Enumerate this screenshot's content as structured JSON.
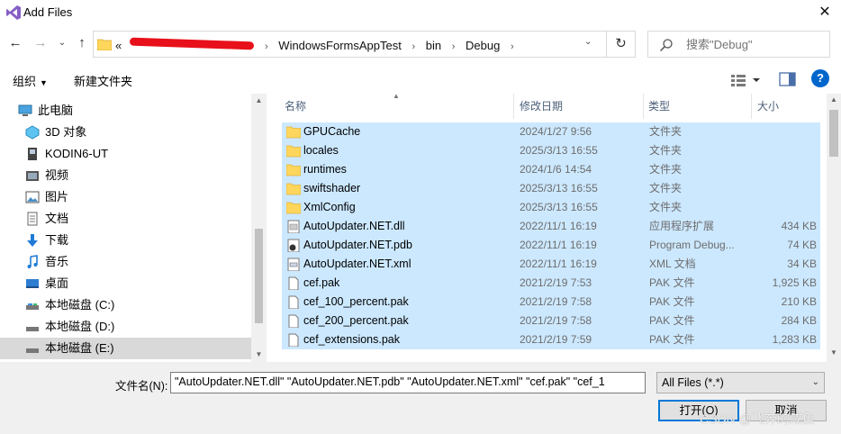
{
  "window": {
    "title": "Add Files",
    "close_glyph": "✕"
  },
  "nav": {
    "back_glyph": "←",
    "forward_glyph": "→",
    "recent_glyph": "⌄",
    "up_glyph": "↑",
    "address_prefix": "«",
    "crumbs": [
      "WindowsFormsAppTest",
      "bin",
      "Debug"
    ],
    "refresh_glyph": "↻",
    "search_placeholder": "搜索\"Debug\""
  },
  "toolbar": {
    "organize": "组织",
    "organize_arrow": "▼",
    "new_folder": "新建文件夹",
    "help": "?"
  },
  "sidebar": {
    "items": [
      {
        "label": "此电脑",
        "icon": "pc-icon"
      },
      {
        "label": "3D 对象",
        "icon": "3d-objects-icon"
      },
      {
        "label": "KODIN6-UT",
        "icon": "drive-icon"
      },
      {
        "label": "视频",
        "icon": "video-icon"
      },
      {
        "label": "图片",
        "icon": "pictures-icon"
      },
      {
        "label": "文档",
        "icon": "documents-icon"
      },
      {
        "label": "下载",
        "icon": "download-icon"
      },
      {
        "label": "音乐",
        "icon": "music-icon"
      },
      {
        "label": "桌面",
        "icon": "desktop-icon"
      },
      {
        "label": "本地磁盘 (C:)",
        "icon": "disk-icon"
      },
      {
        "label": "本地磁盘 (D:)",
        "icon": "disk-icon"
      },
      {
        "label": "本地磁盘 (E:)",
        "icon": "disk-icon"
      }
    ],
    "selected_index": 11
  },
  "columns": {
    "name": "名称",
    "date": "修改日期",
    "type": "类型",
    "size": "大小"
  },
  "files": [
    {
      "name": "GPUCache",
      "date": "2024/1/27 9:56",
      "type": "文件夹",
      "size": "",
      "icon": "folder-icon"
    },
    {
      "name": "locales",
      "date": "2025/3/13 16:55",
      "type": "文件夹",
      "size": "",
      "icon": "folder-icon"
    },
    {
      "name": "runtimes",
      "date": "2024/1/6 14:54",
      "type": "文件夹",
      "size": "",
      "icon": "folder-icon"
    },
    {
      "name": "swiftshader",
      "date": "2025/3/13 16:55",
      "type": "文件夹",
      "size": "",
      "icon": "folder-icon"
    },
    {
      "name": "XmlConfig",
      "date": "2025/3/13 16:55",
      "type": "文件夹",
      "size": "",
      "icon": "folder-icon"
    },
    {
      "name": "AutoUpdater.NET.dll",
      "date": "2022/11/1 16:19",
      "type": "应用程序扩展",
      "size": "434 KB",
      "icon": "dll-icon"
    },
    {
      "name": "AutoUpdater.NET.pdb",
      "date": "2022/11/1 16:19",
      "type": "Program Debug...",
      "size": "74 KB",
      "icon": "pdb-icon"
    },
    {
      "name": "AutoUpdater.NET.xml",
      "date": "2022/11/1 16:19",
      "type": "XML 文档",
      "size": "34 KB",
      "icon": "xml-icon"
    },
    {
      "name": "cef.pak",
      "date": "2021/2/19 7:53",
      "type": "PAK 文件",
      "size": "1,925 KB",
      "icon": "file-icon"
    },
    {
      "name": "cef_100_percent.pak",
      "date": "2021/2/19 7:58",
      "type": "PAK 文件",
      "size": "210 KB",
      "icon": "file-icon"
    },
    {
      "name": "cef_200_percent.pak",
      "date": "2021/2/19 7:58",
      "type": "PAK 文件",
      "size": "284 KB",
      "icon": "file-icon"
    },
    {
      "name": "cef_extensions.pak",
      "date": "2021/2/19 7:59",
      "type": "PAK 文件",
      "size": "1,283 KB",
      "icon": "file-icon"
    }
  ],
  "bottom": {
    "filename_label": "文件名(N):",
    "filename_value": "\"AutoUpdater.NET.dll\" \"AutoUpdater.NET.pdb\" \"AutoUpdater.NET.xml\" \"cef.pak\" \"cef_1",
    "filter_value": "All Files (*.*)",
    "open_label": "打开(O)",
    "cancel_label": "取消"
  },
  "watermark": "CSDN @飞奔的咸鱼",
  "colors": {
    "selection": "#cce8ff",
    "accent": "#0078d7",
    "folder": "#ffd65c",
    "redaction": "#e8101a"
  }
}
